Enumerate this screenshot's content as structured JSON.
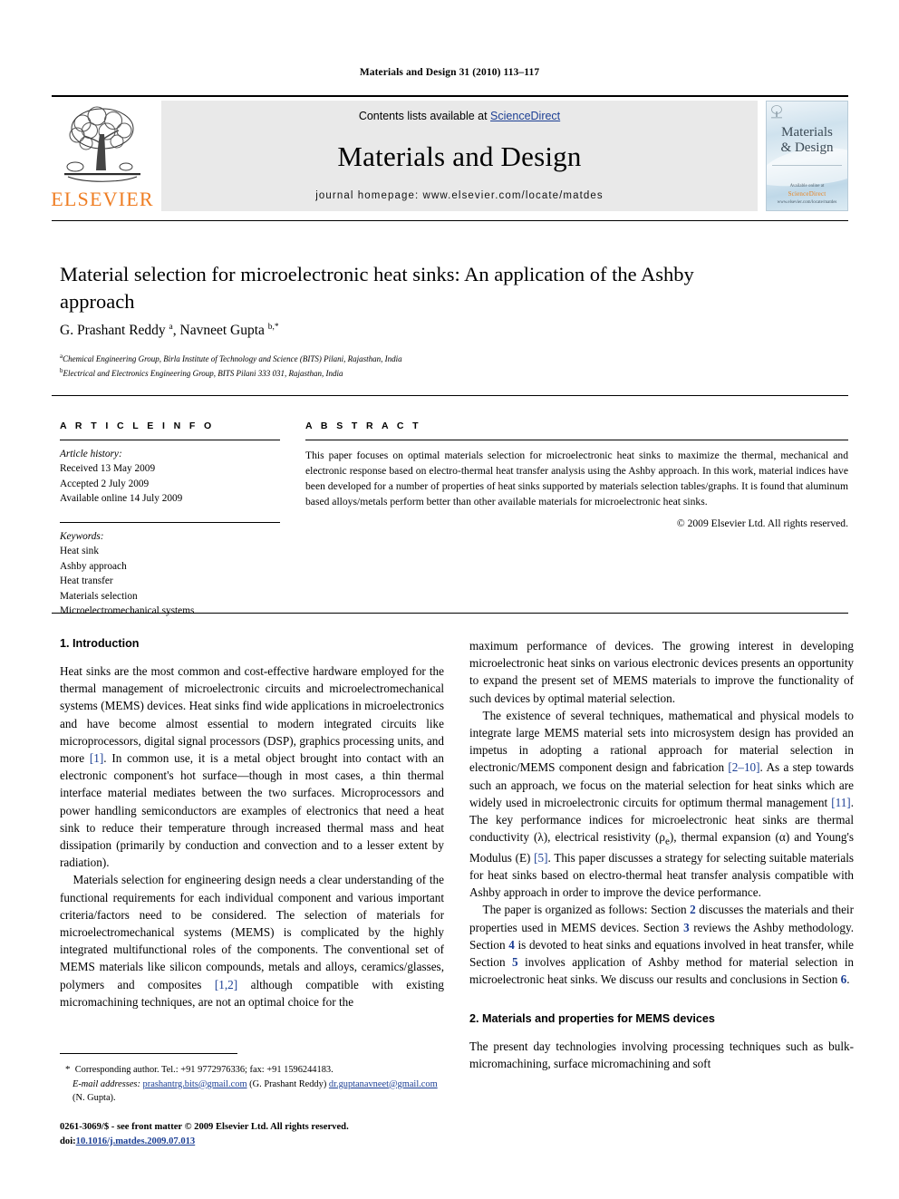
{
  "running_head": "Materials and Design 31 (2010) 113–117",
  "masthead": {
    "publisher_name": "ELSEVIER",
    "contents_prefix": "Contents lists available at ",
    "contents_link": "ScienceDirect",
    "journal_title": "Materials and Design",
    "homepage": "journal homepage: www.elsevier.com/locate/matdes",
    "cover": {
      "title_line1": "Materials",
      "title_line2": "& Design",
      "footer_note": "Available online at",
      "footer_publisher": "ScienceDirect",
      "footer_url": "www.elsevier.com/locate/matdes"
    }
  },
  "article": {
    "title": "Material selection for microelectronic heat sinks: An application of the Ashby approach",
    "authors_html": "G. Prashant Reddy <sup>a</sup>, Navneet Gupta <sup>b,*</sup>",
    "affiliation_a_marker": "a",
    "affiliation_a": "Chemical Engineering Group, Birla Institute of Technology and Science (BITS) Pilani, Rajasthan, India",
    "affiliation_b_marker": "b",
    "affiliation_b": "Electrical and Electronics Engineering Group, BITS Pilani 333 031, Rajasthan, India"
  },
  "info": {
    "heading": "A R T I C L E    I N F O",
    "history_label": "Article history:",
    "history": [
      "Received 13 May 2009",
      "Accepted 2 July 2009",
      "Available online 14 July 2009"
    ],
    "keywords_label": "Keywords:",
    "keywords": [
      "Heat sink",
      "Ashby approach",
      "Heat transfer",
      "Materials selection",
      "Microelectromechanical systems"
    ]
  },
  "abstract": {
    "heading": "A B S T R A C T",
    "text": "This paper focuses on optimal materials selection for microelectronic heat sinks to maximize the thermal, mechanical and electronic response based on electro-thermal heat transfer analysis using the Ashby approach. In this work, material indices have been developed for a number of properties of heat sinks supported by materials selection tables/graphs. It is found that aluminum based alloys/metals perform better than other available materials for microelectronic heat sinks.",
    "copyright": "© 2009 Elsevier Ltd. All rights reserved."
  },
  "body": {
    "section1_heading": "1. Introduction",
    "section2_heading": "2. Materials and properties for MEMS devices",
    "left_p1_a": "Heat sinks are the most common and cost-effective hardware employed for the thermal management of microelectronic circuits and microelectromechanical systems (MEMS) devices. Heat sinks find wide applications in microelectronics and have become almost essential to modern integrated circuits like microprocessors, digital signal processors (DSP), graphics processing units, and more ",
    "left_p1_ref": "[1]",
    "left_p1_b": ". In common use, it is a metal object brought into contact with an electronic component's hot surface—though in most cases, a thin thermal interface material mediates between the two surfaces. Microprocessors and power handling semiconductors are examples of electronics that need a heat sink to reduce their temperature through increased thermal mass and heat dissipation (primarily by conduction and convection and to a lesser extent by radiation).",
    "left_p2_a": "Materials selection for engineering design needs a clear understanding of the functional requirements for each individual component and various important criteria/factors need to be considered. The selection of materials for microelectromechanical systems (MEMS) is complicated by the highly integrated multifunctional roles of the components. The conventional set of MEMS materials like silicon compounds, metals and alloys, ceramics/glasses, polymers and composites ",
    "left_p2_ref": "[1,2]",
    "left_p2_b": " although compatible with existing micromachining techniques, are not an optimal choice for the",
    "right_p1": "maximum performance of devices. The growing interest in developing microelectronic heat sinks on various electronic devices presents an opportunity to expand the present set of MEMS materials to improve the functionality of such devices by optimal material selection.",
    "right_p2_a": "The existence of several techniques, mathematical and physical models to integrate large MEMS material sets into microsystem design has provided an impetus in adopting a rational approach for material selection in electronic/MEMS component design and fabrication ",
    "right_p2_ref1": "[2–10]",
    "right_p2_b": ". As a step towards such an approach, we focus on the material selection for heat sinks which are widely used in microelectronic circuits for optimum thermal management ",
    "right_p2_ref2": "[11]",
    "right_p2_c": ". The key performance indices for microelectronic heat sinks are thermal conductivity (λ), electrical resistivity (ρ",
    "right_p2_sub": "e",
    "right_p2_d": "), thermal expansion (α) and Young's Modulus (E) ",
    "right_p2_ref3": "[5]",
    "right_p2_e": ". This paper discusses a strategy for selecting suitable materials for heat sinks based on electro-thermal heat transfer analysis compatible with Ashby approach in order to improve the device performance.",
    "right_p3_a": "The paper is organized as follows: Section ",
    "right_p3_n1": "2",
    "right_p3_b": " discusses the materials and their properties used in MEMS devices. Section ",
    "right_p3_n2": "3",
    "right_p3_c": " reviews the Ashby methodology. Section ",
    "right_p3_n3": "4",
    "right_p3_d": " is devoted to heat sinks and equations involved in heat transfer, while Section ",
    "right_p3_n4": "5",
    "right_p3_e": " involves application of Ashby method for material selection in microelectronic heat sinks. We discuss our results and conclusions in Section ",
    "right_p3_n5": "6",
    "right_p3_f": ".",
    "right_p4": "The present day technologies involving processing techniques such as bulk-micromachining, surface micromachining and soft"
  },
  "footnotes": {
    "star": "*",
    "corresponding": "Corresponding author. Tel.: +91 9772976336; fax: +91 1596244183.",
    "email_label": "E-mail addresses:",
    "email1": "prashantrg.bits@gmail.com",
    "email1_owner": "(G. Prashant Reddy)",
    "email2": "dr.guptanavneet@gmail.com",
    "email2_owner": "(N. Gupta).",
    "issn_line": "0261-3069/$ - see front matter © 2009 Elsevier Ltd. All rights reserved.",
    "doi_label": "doi:",
    "doi_value": "10.1016/j.matdes.2009.07.013"
  },
  "colors": {
    "link_blue": "#1c3f94",
    "elsevier_orange": "#ef7d22",
    "band_gray": "#e9e9e9"
  }
}
